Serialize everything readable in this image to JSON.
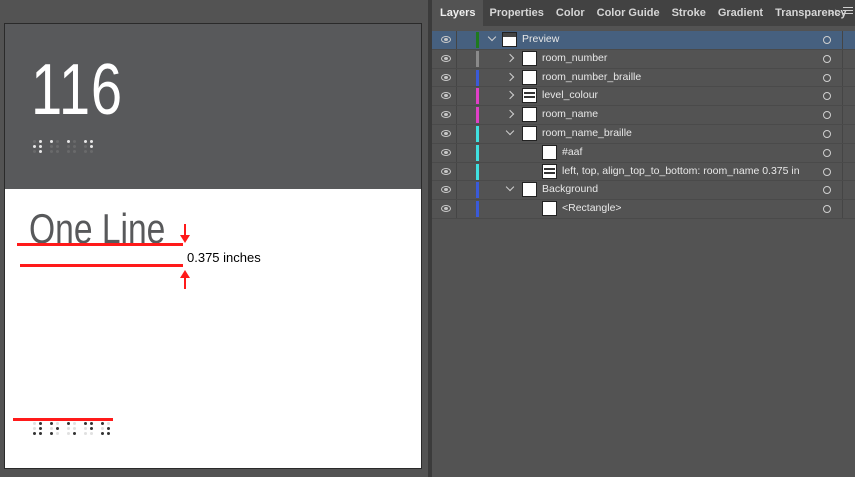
{
  "canvas": {
    "room_number": "116",
    "room_name": "One Line",
    "measurement_label": "0.375 inches",
    "guide_color": "#ff1a1a",
    "sign_color": "#58595b"
  },
  "panel": {
    "tabs": [
      {
        "label": "Layers",
        "active": true
      },
      {
        "label": "Properties"
      },
      {
        "label": "Color"
      },
      {
        "label": "Color Guide"
      },
      {
        "label": "Stroke"
      },
      {
        "label": "Gradient"
      },
      {
        "label": "Transparency"
      }
    ],
    "overflow_icon": "double-chevron-right-icon",
    "menu_icon": "hamburger-menu-icon"
  },
  "layers": [
    {
      "name": "Preview",
      "level": 0,
      "expand": "down",
      "color": "#1f7a1f",
      "thumb": "bar",
      "selected": true
    },
    {
      "name": "room_number",
      "level": 1,
      "expand": "right",
      "color": "#8a8a8a",
      "thumb": "plain"
    },
    {
      "name": "room_number_braille",
      "level": 1,
      "expand": "right",
      "color": "#3a5ad8",
      "thumb": "plain"
    },
    {
      "name": "level_colour",
      "level": 1,
      "expand": "right",
      "color": "#e040c8",
      "thumb": "striped"
    },
    {
      "name": "room_name",
      "level": 1,
      "expand": "right",
      "color": "#e040c8",
      "thumb": "plain"
    },
    {
      "name": "room_name_braille",
      "level": 1,
      "expand": "down",
      "color": "#40e0e0",
      "thumb": "plain"
    },
    {
      "name": "#aaf",
      "level": 2,
      "expand": "none",
      "color": "#40e0e0",
      "thumb": "plain"
    },
    {
      "name": "left, top, align_top_to_bottom: room_name 0.375 in",
      "level": 2,
      "expand": "none",
      "color": "#40e0e0",
      "thumb": "striped"
    },
    {
      "name": "Background",
      "level": 1,
      "expand": "down",
      "color": "#3a5ad8",
      "thumb": "plain"
    },
    {
      "name": "<Rectangle>",
      "level": 2,
      "expand": "none",
      "color": "#3a5ad8",
      "thumb": "plain"
    }
  ]
}
